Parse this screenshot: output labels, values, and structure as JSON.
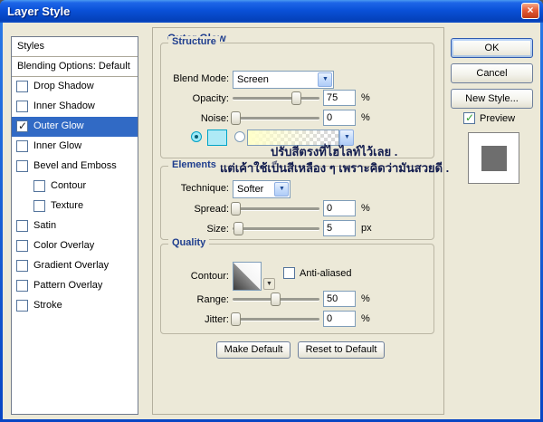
{
  "window": {
    "title": "Layer Style",
    "close_glyph": "×"
  },
  "sidebar": {
    "items": [
      {
        "label": "Styles"
      },
      {
        "label": "Blending Options: Default"
      },
      {
        "label": "Drop Shadow",
        "checked": false
      },
      {
        "label": "Inner Shadow",
        "checked": false
      },
      {
        "label": "Outer Glow",
        "checked": true,
        "selected": true
      },
      {
        "label": "Inner Glow",
        "checked": false
      },
      {
        "label": "Bevel and Emboss",
        "checked": false
      },
      {
        "label": "Contour",
        "checked": false,
        "indent": true
      },
      {
        "label": "Texture",
        "checked": false,
        "indent": true
      },
      {
        "label": "Satin",
        "checked": false
      },
      {
        "label": "Color Overlay",
        "checked": false
      },
      {
        "label": "Gradient Overlay",
        "checked": false
      },
      {
        "label": "Pattern Overlay",
        "checked": false
      },
      {
        "label": "Stroke",
        "checked": false
      }
    ]
  },
  "panel": {
    "title": "Outer Glow",
    "structure": {
      "legend": "Structure",
      "blend_mode": {
        "label": "Blend Mode:",
        "value": "Screen"
      },
      "opacity": {
        "label": "Opacity:",
        "value": "75",
        "unit": "%"
      },
      "noise": {
        "label": "Noise:",
        "value": "0",
        "unit": "%"
      },
      "color_mode": "solid-color-selected"
    },
    "annotation": {
      "line1": "ปรับสีตรงที่ไฮไลท์ไว้เลย .",
      "line2": "แต่เค้าใช้เป็นสีเหลือง ๆ เพราะคิดว่ามันสวยดี ."
    },
    "elements": {
      "legend": "Elements",
      "technique": {
        "label": "Technique:",
        "value": "Softer"
      },
      "spread": {
        "label": "Spread:",
        "value": "0",
        "unit": "%"
      },
      "size": {
        "label": "Size:",
        "value": "5",
        "unit": "px"
      }
    },
    "quality": {
      "legend": "Quality",
      "contour": {
        "label": "Contour:"
      },
      "antialiased": {
        "label": "Anti-aliased",
        "checked": false
      },
      "range": {
        "label": "Range:",
        "value": "50",
        "unit": "%"
      },
      "jitter": {
        "label": "Jitter:",
        "value": "0",
        "unit": "%"
      }
    },
    "footer": {
      "make_default": "Make Default",
      "reset_default": "Reset to Default"
    }
  },
  "actions": {
    "ok": "OK",
    "cancel": "Cancel",
    "new_style": "New Style...",
    "preview": "Preview",
    "preview_checked": true
  },
  "colors": {
    "titlebar_blue": "#0a51d8",
    "selection_blue": "#316ac5",
    "highlight_cyan": "#9de9f7",
    "glow_yellow": "#ffffc9",
    "group_title_navy": "#1f3e8e",
    "dialog_bg": "#ece9d8"
  }
}
